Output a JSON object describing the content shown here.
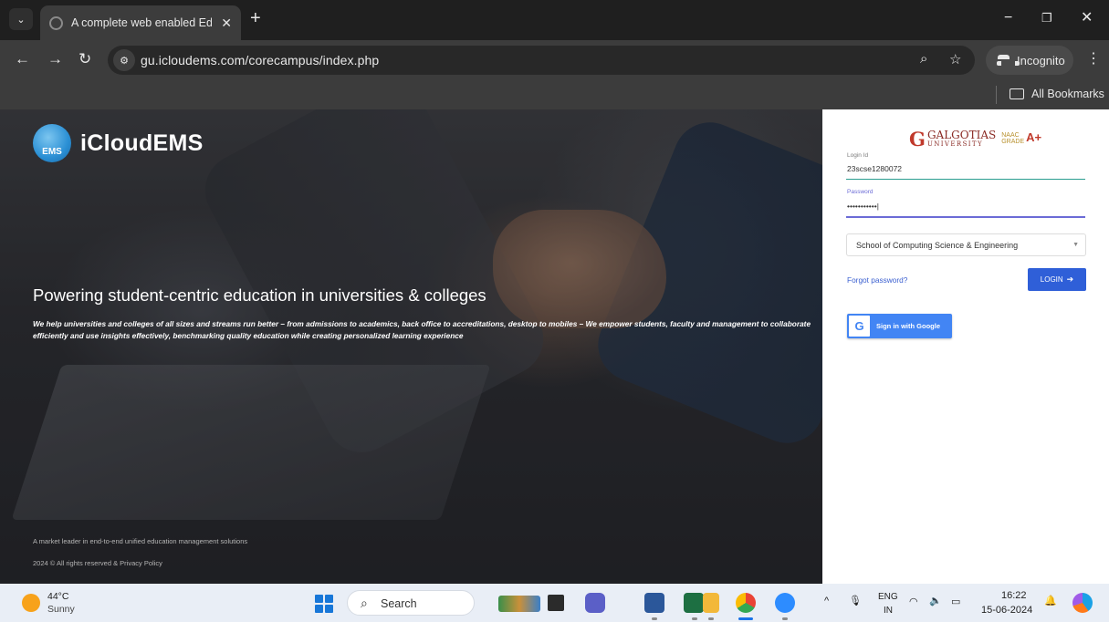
{
  "browser": {
    "tab_title": "A complete web enabled Educa",
    "tab_close": "✕",
    "new_tab": "+",
    "url": "gu.icloudems.com/corecampus/index.php",
    "incognito_label": "Incognito",
    "bookmarks_label": "All Bookmarks"
  },
  "hero": {
    "logo_text": "iCloudEMS",
    "logo_badge_text": "EMS",
    "headline": "Powering student-centric education in universities & colleges",
    "subtext": "We help universities and colleges of all sizes and streams run better – from admissions to academics, back office to accreditations, desktop to mobiles – We empower students, faculty and management to collaborate efficiently and use insights effectively, benchmarking quality education while creating personalized learning experience",
    "footer_tagline": "A market leader in end-to-end unified education management solutions",
    "footer_copyright": "2024 © All rights reserved & Privacy Policy"
  },
  "login": {
    "university_g": "G",
    "university_name": "GALGOTIAS",
    "university_sub": "UNIVERSITY",
    "naac_label": "NAAC",
    "naac_grade_label": "GRADE",
    "naac_grade": "A+",
    "login_id_label": "Login Id",
    "login_id_value": "23scse1280072",
    "password_label": "Password",
    "password_value": "•••••••••••|",
    "school_select": "School of Computing Science & Engineering",
    "forgot_password": "Forgot password?",
    "login_button": "LOGIN",
    "google_button": "Sign in with Google",
    "google_letter": "G",
    "accent_color": "#2f5fd8",
    "login_line_color": "#2a9d8f",
    "password_line_color": "#6b6bd6"
  },
  "taskbar": {
    "weather_temp": "44°C",
    "weather_condition": "Sunny",
    "search_label": "Search",
    "lang_line1": "ENG",
    "lang_line2": "IN",
    "time": "16:22",
    "date": "15-06-2024"
  }
}
